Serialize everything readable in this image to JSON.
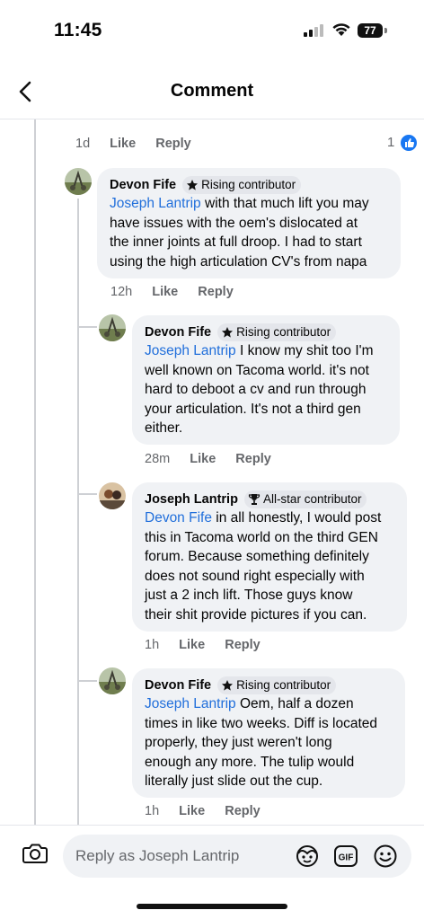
{
  "status_bar": {
    "time": "11:45",
    "battery": "77"
  },
  "header": {
    "title": "Comment",
    "back_icon": "chevron-left-icon"
  },
  "top_comment_meta": {
    "time": "1d",
    "like": "Like",
    "reply": "Reply",
    "reaction_count": "1",
    "reaction_icon": "thumbs-up-icon"
  },
  "comments": [
    {
      "author": "Devon Fife",
      "badge": "Rising contributor",
      "badge_icon": "star-icon",
      "mention": "Joseph Lantrip",
      "lines": [
        " with that much lift you may",
        "have issues with the oem's dislocated at",
        "the inner joints at full droop. I had to start",
        "using the high articulation CV's from napa"
      ],
      "time": "12h",
      "like": "Like",
      "reply": "Reply"
    },
    {
      "author": "Devon Fife",
      "badge": "Rising contributor",
      "badge_icon": "star-icon",
      "mention": "Joseph Lantrip",
      "lines": [
        " I know my shit too I'm",
        "well known on Tacoma world. it's not",
        "hard to deboot a cv and run through",
        "your articulation. It's not a third gen",
        "either."
      ],
      "time": "28m",
      "like": "Like",
      "reply": "Reply"
    },
    {
      "author": "Joseph Lantrip",
      "badge": "All-star contributor",
      "badge_icon": "trophy-icon",
      "mention": "Devon Fife",
      "lines": [
        " in all honestly, I would post",
        "this in Tacoma world on the third GEN",
        "forum. Because something definitely",
        "does not sound right especially with",
        "just a 2 inch lift. Those guys know",
        "their shit provide pictures if you can."
      ],
      "time": "1h",
      "like": "Like",
      "reply": "Reply"
    },
    {
      "author": "Devon Fife",
      "badge": "Rising contributor",
      "badge_icon": "star-icon",
      "mention": "Joseph Lantrip",
      "lines": [
        " Oem, half a dozen",
        "times in like two weeks. Diff is located",
        "properly, they just weren't long",
        "enough any more. The tulip would",
        "literally just slide out the cup."
      ],
      "time": "1h",
      "like": "Like",
      "reply": "Reply"
    }
  ],
  "composer": {
    "placeholder": "Reply as Joseph Lantrip",
    "camera_icon": "camera-icon",
    "avatar_sticker_icon": "avatar-sticker-icon",
    "gif_icon": "gif-icon",
    "emoji_icon": "emoji-icon"
  },
  "colors": {
    "mention": "#216fdb",
    "bubble": "#f0f2f5",
    "meta": "#65676b",
    "reaction": "#1877f2"
  }
}
